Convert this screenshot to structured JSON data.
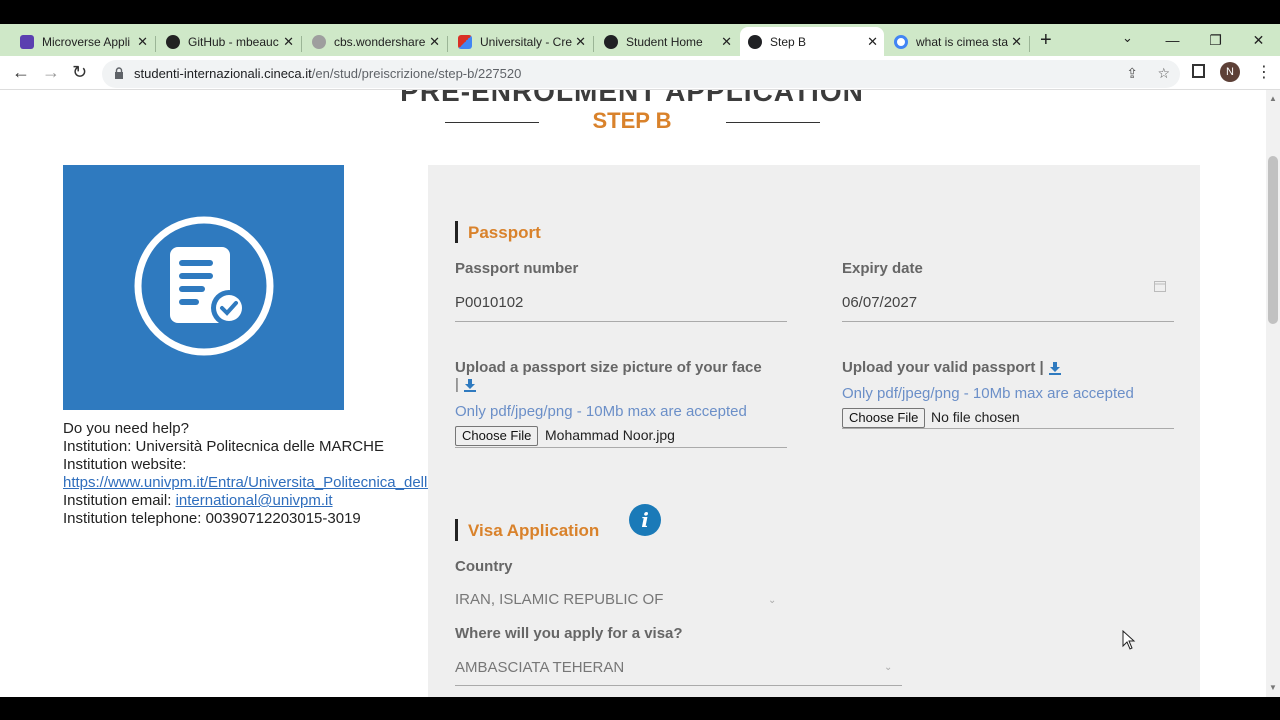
{
  "tabs": [
    {
      "label": "Microverse Appli",
      "icon": "microverse-icon",
      "color": "#5b3fb0"
    },
    {
      "label": "GitHub - mbeauc",
      "icon": "github-icon",
      "color": "#222222"
    },
    {
      "label": "cbs.wondershare",
      "icon": "globe-icon",
      "color": "#9e9e9e"
    },
    {
      "label": "Universitaly - Cre",
      "icon": "gmail-icon",
      "color": "#d93025"
    },
    {
      "label": "Student Home",
      "icon": "globe-icon",
      "color": "#202124"
    },
    {
      "label": "Step B",
      "icon": "globe-icon",
      "color": "#202124"
    },
    {
      "label": "what is cimea sta",
      "icon": "google-icon",
      "color": "#4285f4"
    }
  ],
  "address": {
    "host": "studenti-internazionali.cineca.it",
    "path": "/en/stud/preiscrizione/step-b/227520"
  },
  "profile_initial": "N",
  "page": {
    "heading": "PRE-ENROLMENT APPLICATION",
    "step": "STEP B"
  },
  "help": {
    "question": "Do you need help?",
    "institution_label": "Institution: ",
    "institution": "Università Politecnica delle MARCHE",
    "website_label": "Institution website:",
    "website": "https://www.univpm.it/Entra/Universita_Politecnica_delle_Marche",
    "email_label": "Institution email: ",
    "email": "international@univpm.it",
    "phone_label": "Institution telephone: ",
    "phone": "00390712203015-3019"
  },
  "passport": {
    "title": "Passport",
    "number_label": "Passport number",
    "number": "P0010102",
    "expiry_label": "Expiry date",
    "expiry": "06/07/2027",
    "photo_label": "Upload a passport size picture of your face",
    "photo_note": "Only pdf/jpeg/png - 10Mb max are accepted",
    "photo_button": "Choose File",
    "photo_file": "Mohammad Noor.jpg",
    "passport_label": "Upload your valid passport |",
    "passport_note": "Only pdf/jpeg/png - 10Mb max are accepted",
    "passport_button": "Choose File",
    "passport_file": "No file chosen"
  },
  "visa": {
    "title": "Visa Application",
    "country_label": "Country",
    "country": "IRAN, ISLAMIC REPUBLIC OF",
    "apply_label": "Where will you apply for a visa?",
    "apply": "AMBASCIATA TEHERAN"
  },
  "colors": {
    "accent": "#d9822b",
    "logo_bg": "#2f7abf",
    "note": "#6b8fc8",
    "info": "#1a7ab8"
  }
}
